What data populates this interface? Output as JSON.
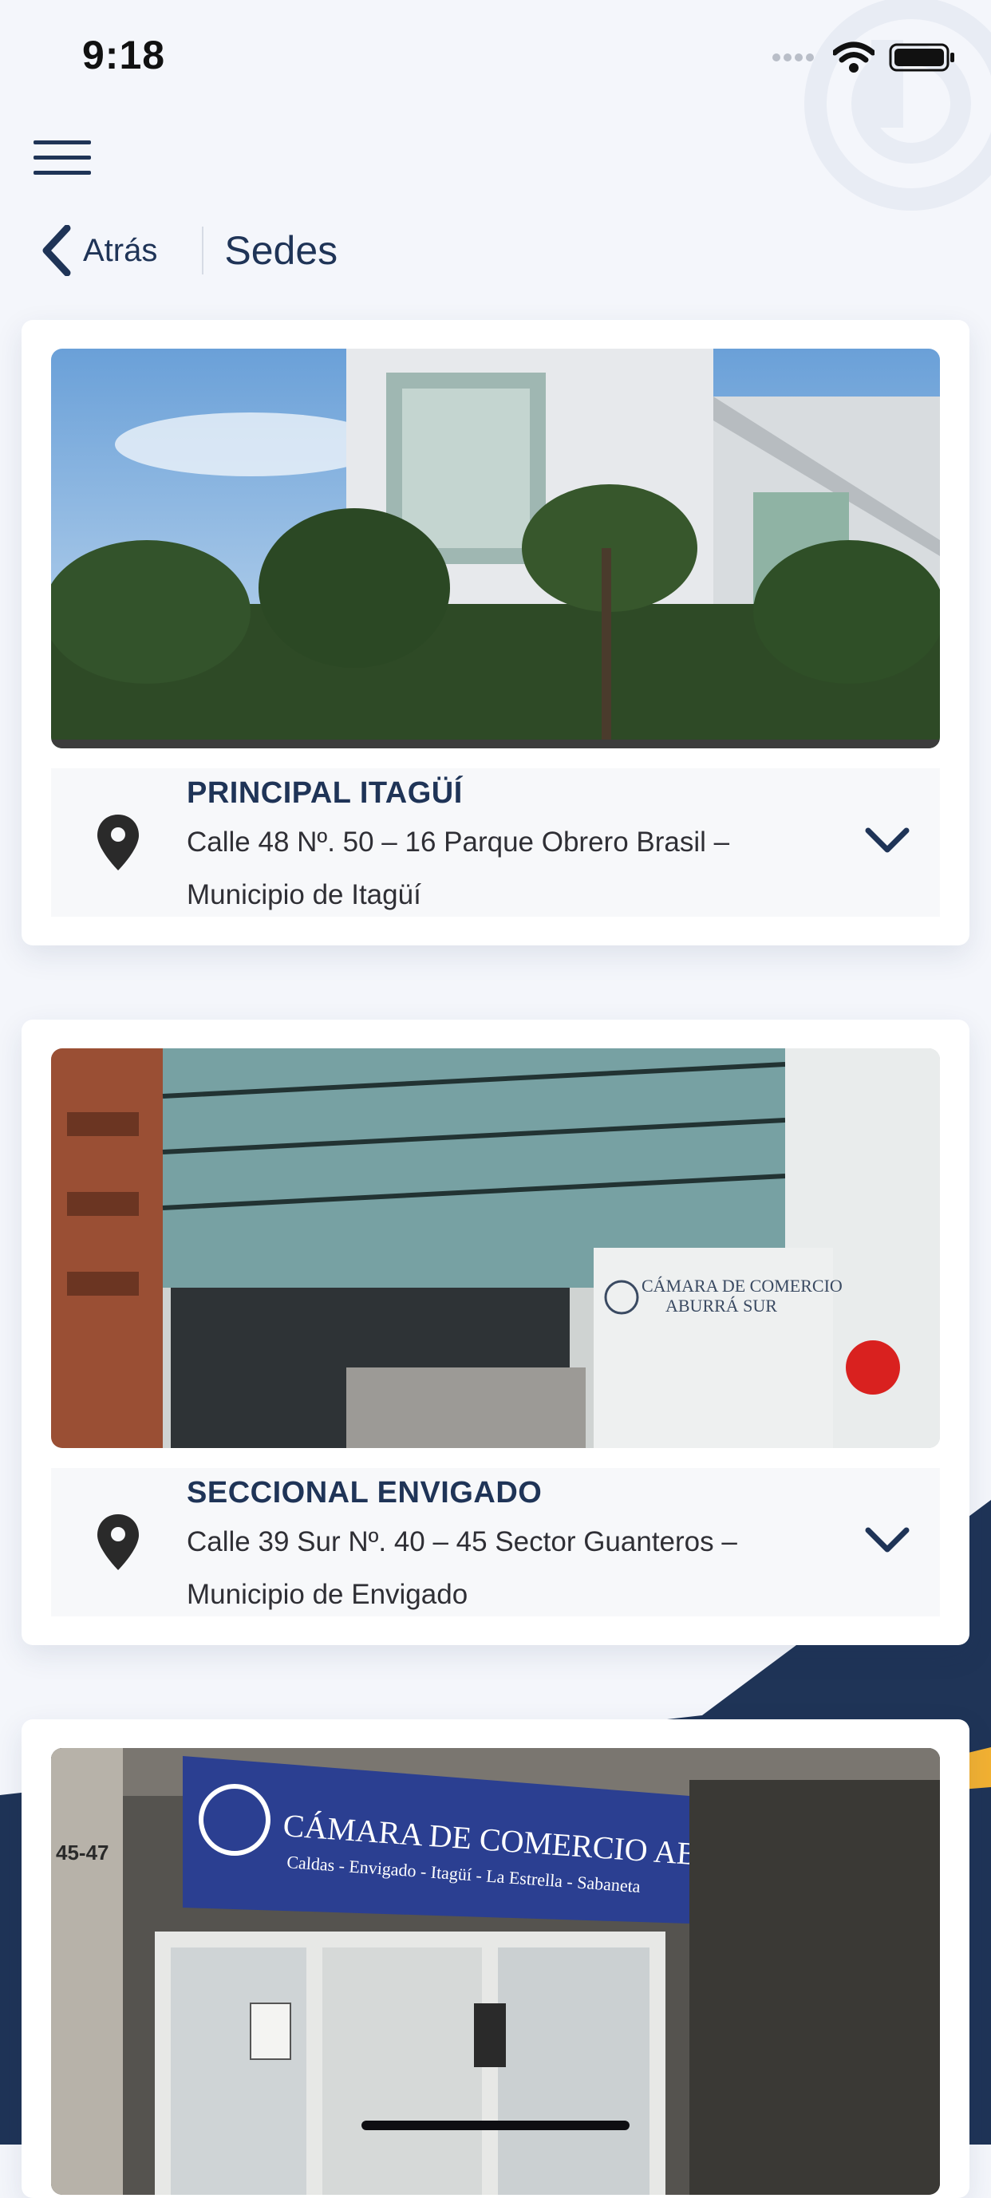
{
  "status_bar": {
    "time": "9:18"
  },
  "nav": {
    "back_label": "Atrás",
    "title": "Sedes"
  },
  "locations": [
    {
      "name": "PRINCIPAL ITAGÜÍ",
      "address": "Calle 48 Nº. 50 – 16 Parque Obrero Brasil – Municipio de Itagüí"
    },
    {
      "name": "SECCIONAL ENVIGADO",
      "address": "Calle 39 Sur Nº. 40 – 45 Sector Guanteros – Municipio de Envigado"
    },
    {
      "name": "",
      "address": ""
    }
  ],
  "photo3_sign": {
    "title": "CÁMARA DE COMERCIO ABURRÁ SUR",
    "subtitle": "Caldas - Envigado - Itagüí - La Estrella - Sabaneta",
    "number": "45-47"
  },
  "photo2_sign": {
    "line1": "CÁMARA DE COMERCIO",
    "line2": "ABURRÁ SUR"
  },
  "colors": {
    "navy": "#1f3457",
    "accent_yellow": "#f2b132",
    "background": "#f4f6fb"
  }
}
